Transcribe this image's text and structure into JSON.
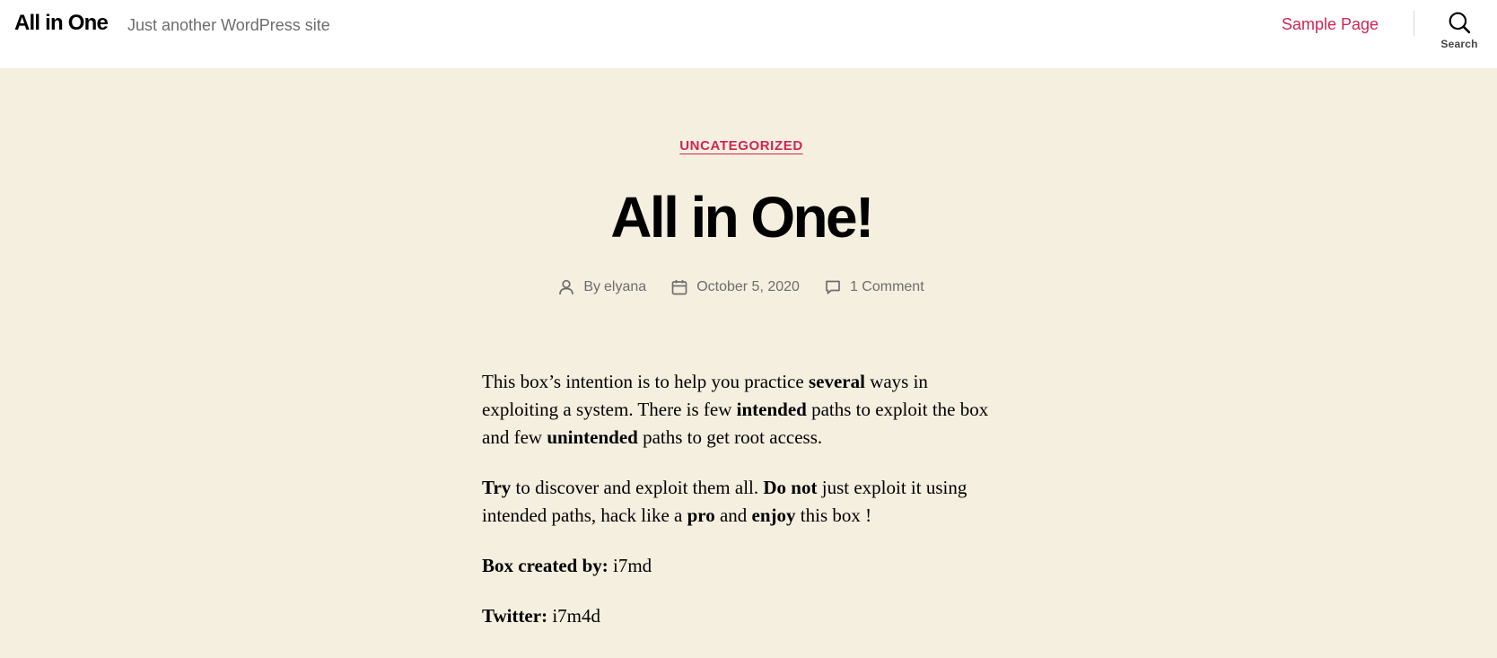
{
  "header": {
    "site_title": "All in One",
    "tagline": "Just another WordPress site",
    "nav": [
      {
        "label": "Sample Page"
      }
    ],
    "search_label": "Search",
    "search_icon": "search-icon"
  },
  "post": {
    "category": "UNCATEGORIZED",
    "title": "All in One!",
    "meta": {
      "by_label": "By",
      "author": "elyana",
      "date": "October 5, 2020",
      "comments": "1 Comment",
      "icons": [
        "user-icon",
        "calendar-icon",
        "comment-icon"
      ]
    },
    "content": {
      "p1": {
        "a": "This box’s intention is to help you practice ",
        "b": "several",
        "c": " ways in exploiting a system. There is few ",
        "d": "intended",
        "e": " paths to exploit the box and few ",
        "f": "unintended",
        "g": " paths to get root access."
      },
      "p2": {
        "a": "Try",
        "b": " to discover and exploit them all. ",
        "c": "Do not",
        "d": " just exploit it using intended paths, hack like a ",
        "e": "pro",
        "f": " and ",
        "g": "enjoy",
        "h": " this box !"
      },
      "p3": {
        "label": "Box created by:",
        "value": " i7md"
      },
      "p4": {
        "label": "Twitter:",
        "value": " i7m4d"
      }
    }
  },
  "colors": {
    "accent": "#cd2653",
    "background": "#f5efe0",
    "header_bg": "#ffffff",
    "meta_text": "#6d6d6d"
  }
}
